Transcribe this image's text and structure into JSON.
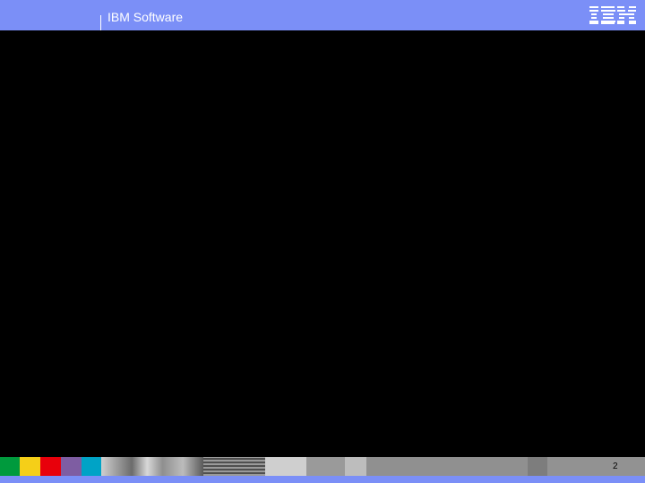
{
  "header": {
    "title": "IBM Software",
    "logo_icon": "ibm-logo",
    "background_color": "#7b8ff7"
  },
  "footer": {
    "page_number": "2",
    "color_swatches": [
      "#009a3d",
      "#f5cf18",
      "#e8000b",
      "#7e5da2",
      "#00a3c6"
    ]
  }
}
